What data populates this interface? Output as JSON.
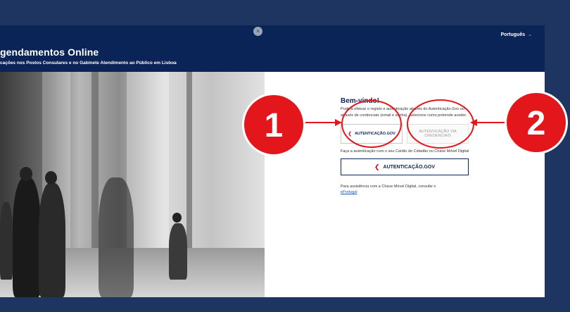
{
  "header": {
    "title": "gendamentos Online",
    "subtitle": "cações nos Postos Consulares e no Gabinete Atendimento ao Público em Lisboa",
    "language": "Português"
  },
  "main": {
    "welcome": "Bem-vindo!",
    "intro": "Poderá efetuar o registo e autenticação através do Autenticação.Gov ou através de credenciais (email e senha). Selecione como pretende aceder.",
    "option_autgov": "AUTENTICAÇÃO.GOV",
    "option_credentials_line1": "AUTENTICAÇÃO VIA",
    "option_credentials_line2": "CREDENCIAIS",
    "autgov_desc": "Faça a autenticação com o seu Cartão do Cidadão ou Chave Móvel Digital",
    "autgov_button": "AUTENTICAÇÃO.GOV",
    "help_text": "Para assistência com a Chave Móvel Digital, consulte o",
    "help_link": "ePortugal"
  },
  "annotations": {
    "badge1": "1",
    "badge2": "2",
    "color": "#e3161c"
  },
  "icons": {
    "autgov": "autenticacao-gov-icon",
    "close": "close-icon",
    "chevron": "chevron-down-icon"
  }
}
